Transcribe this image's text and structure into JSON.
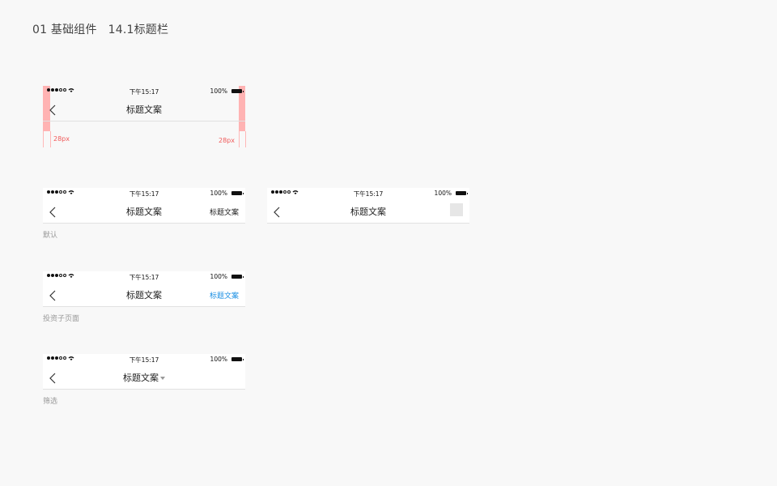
{
  "header": {
    "title": "01 基础组件   14.1标题栏"
  },
  "status_bar": {
    "time": "下午15:17",
    "battery": "100%"
  },
  "spec": {
    "title": "标题文案",
    "left_spacing": "28px",
    "right_spacing": "28px",
    "spacing_color": "#ffb3b3"
  },
  "variants": {
    "default": {
      "title": "标题文案",
      "right_label": "标题文案",
      "caption": "默认"
    },
    "icon": {
      "title": "标题文案"
    },
    "invest": {
      "title": "标题文案",
      "right_label": "标题文案",
      "right_color": "#1a8fe3",
      "caption": "投资子页面"
    },
    "filter": {
      "title": "标题文案",
      "caption": "筛选"
    }
  },
  "icons": {
    "back": "chevron-left-icon",
    "wifi": "wifi-icon",
    "battery": "battery-icon",
    "dropdown": "caret-down-icon",
    "action": "placeholder-square-icon"
  }
}
